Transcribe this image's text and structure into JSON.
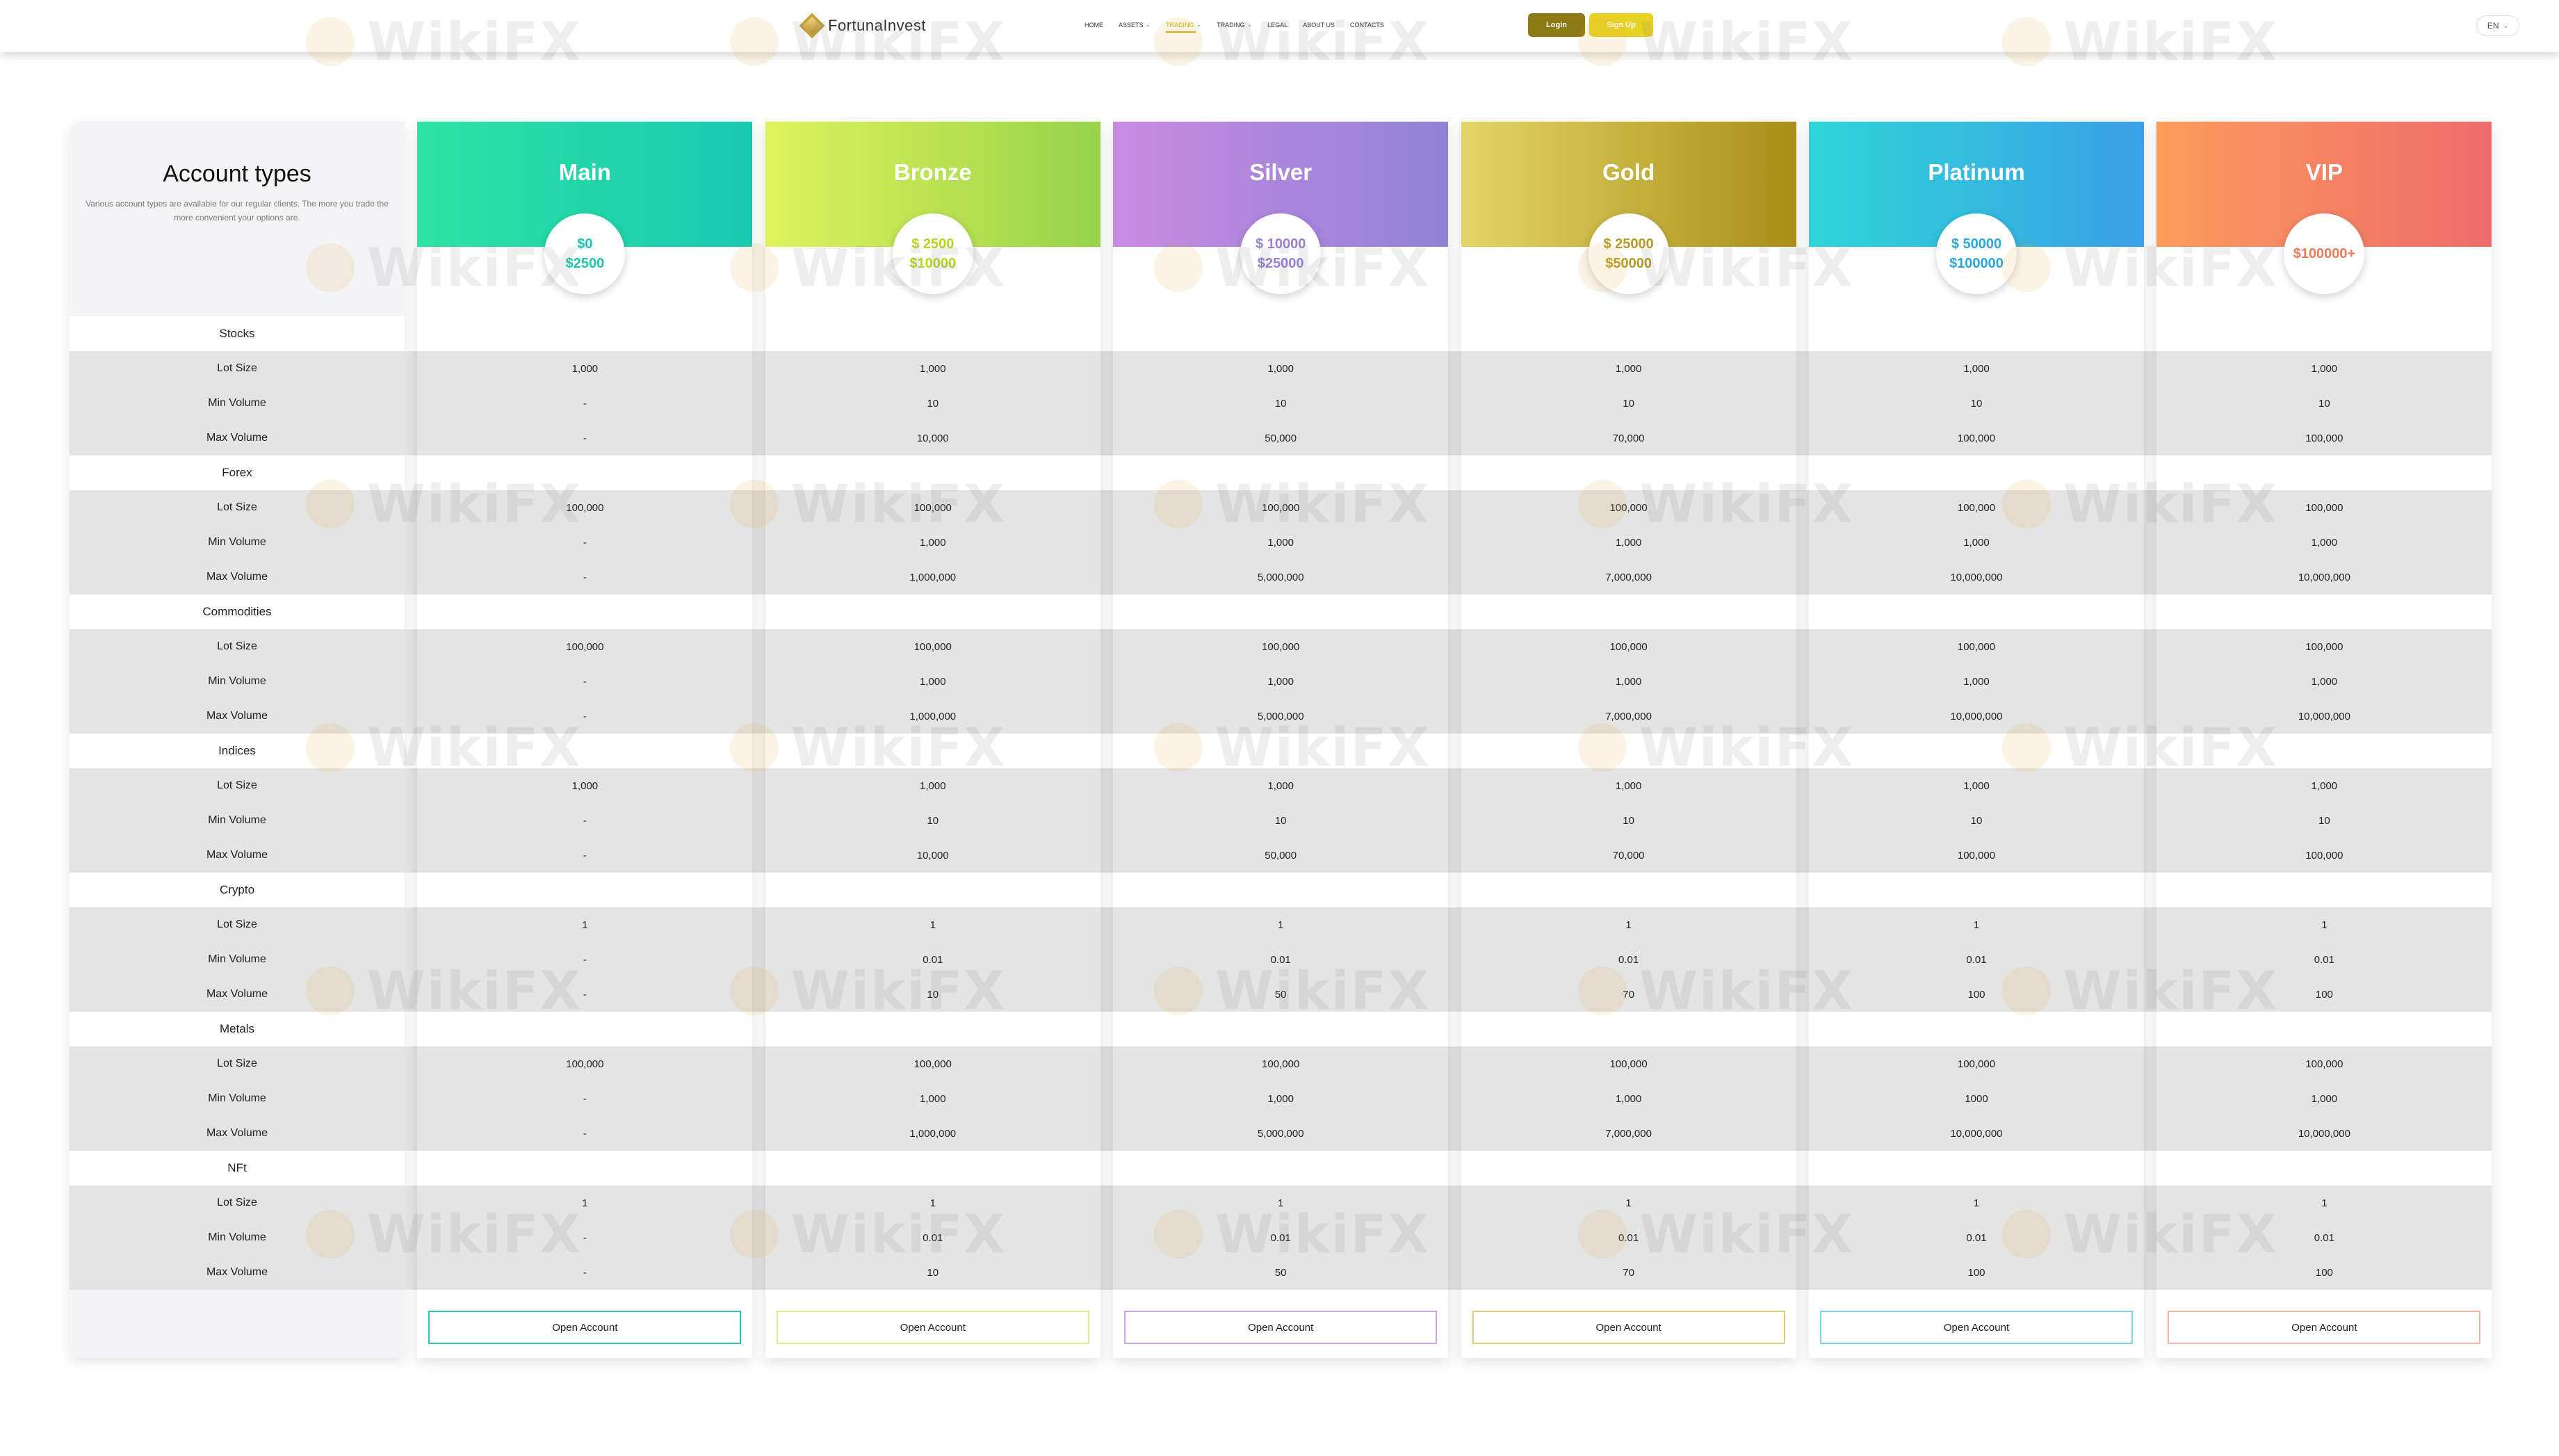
{
  "header": {
    "brand": "FortunaInvest",
    "nav": [
      {
        "label": "HOME",
        "dropdown": false,
        "active": false
      },
      {
        "label": "ASSETS",
        "dropdown": true,
        "active": false
      },
      {
        "label": "TRADING",
        "dropdown": true,
        "active": true
      },
      {
        "label": "TRADING",
        "dropdown": true,
        "active": false
      },
      {
        "label": "LEGAL",
        "dropdown": false,
        "active": false
      },
      {
        "label": "ABOUT US",
        "dropdown": false,
        "active": false
      },
      {
        "label": "CONTACTS",
        "dropdown": false,
        "active": false
      }
    ],
    "login_label": "Login",
    "signup_label": "Sign Up",
    "language": "EN"
  },
  "intro": {
    "title": "Account types",
    "description": "Various account types are available for our regular clients. The more you trade the more convenient your options are."
  },
  "accounts": [
    {
      "name": "Main",
      "price_lines": [
        "$0",
        "$2500"
      ],
      "price_color": "#1cc4ac",
      "gradient": [
        "#2be3a3",
        "#18c9b2"
      ],
      "button_border": "#2ac6b8"
    },
    {
      "name": "Bronze",
      "price_lines": [
        "$ 2500",
        "$10000"
      ],
      "price_color": "#b6d61f",
      "gradient": [
        "#def35a",
        "#96d24a"
      ],
      "button_border": "#d9ef8f"
    },
    {
      "name": "Silver",
      "price_lines": [
        "$ 10000",
        "$25000"
      ],
      "price_color": "#9b7fd8",
      "gradient": [
        "#c98ae0",
        "#8f82d8"
      ],
      "button_border": "#c9a5ea"
    },
    {
      "name": "Gold",
      "price_lines": [
        "$ 25000",
        "$50000"
      ],
      "price_color": "#b39a26",
      "gradient": [
        "#e3d565",
        "#a88d18"
      ],
      "button_border": "#dccf7a"
    },
    {
      "name": "Platinum",
      "price_lines": [
        "$ 50000",
        "$100000"
      ],
      "price_color": "#2aa6dd",
      "gradient": [
        "#2ed5d8",
        "#3aa0e6"
      ],
      "button_border": "#7fd3e3"
    },
    {
      "name": "VIP",
      "price_lines": [
        "$100000+"
      ],
      "price_color": "#ee7a5a",
      "gradient": [
        "#ff9a5c",
        "#ec6c6a"
      ],
      "button_border": "#f6b5a0"
    }
  ],
  "sections": [
    {
      "name": "Stocks",
      "rows": [
        {
          "label": "Lot Size",
          "values": [
            "1,000",
            "1,000",
            "1,000",
            "1,000",
            "1,000",
            "1,000"
          ]
        },
        {
          "label": "Min Volume",
          "values": [
            "-",
            "10",
            "10",
            "10",
            "10",
            "10"
          ]
        },
        {
          "label": "Max Volume",
          "values": [
            "-",
            "10,000",
            "50,000",
            "70,000",
            "100,000",
            "100,000"
          ]
        }
      ]
    },
    {
      "name": "Forex",
      "rows": [
        {
          "label": "Lot Size",
          "values": [
            "100,000",
            "100,000",
            "100,000",
            "100,000",
            "100,000",
            "100,000"
          ]
        },
        {
          "label": "Min Volume",
          "values": [
            "-",
            "1,000",
            "1,000",
            "1,000",
            "1,000",
            "1,000"
          ]
        },
        {
          "label": "Max Volume",
          "values": [
            "-",
            "1,000,000",
            "5,000,000",
            "7,000,000",
            "10,000,000",
            "10,000,000"
          ]
        }
      ]
    },
    {
      "name": "Commodities",
      "rows": [
        {
          "label": "Lot Size",
          "values": [
            "100,000",
            "100,000",
            "100,000",
            "100,000",
            "100,000",
            "100,000"
          ]
        },
        {
          "label": "Min Volume",
          "values": [
            "-",
            "1,000",
            "1,000",
            "1,000",
            "1,000",
            "1,000"
          ]
        },
        {
          "label": "Max Volume",
          "values": [
            "-",
            "1,000,000",
            "5,000,000",
            "7,000,000",
            "10,000,000",
            "10,000,000"
          ]
        }
      ]
    },
    {
      "name": "Indices",
      "rows": [
        {
          "label": "Lot Size",
          "values": [
            "1,000",
            "1,000",
            "1,000",
            "1,000",
            "1,000",
            "1,000"
          ]
        },
        {
          "label": "Min Volume",
          "values": [
            "-",
            "10",
            "10",
            "10",
            "10",
            "10"
          ]
        },
        {
          "label": "Max Volume",
          "values": [
            "-",
            "10,000",
            "50,000",
            "70,000",
            "100,000",
            "100,000"
          ]
        }
      ]
    },
    {
      "name": "Crypto",
      "rows": [
        {
          "label": "Lot Size",
          "values": [
            "1",
            "1",
            "1",
            "1",
            "1",
            "1"
          ]
        },
        {
          "label": "Min Volume",
          "values": [
            "-",
            "0.01",
            "0.01",
            "0.01",
            "0.01",
            "0.01"
          ]
        },
        {
          "label": "Max Volume",
          "values": [
            "-",
            "10",
            "50",
            "70",
            "100",
            "100"
          ]
        }
      ]
    },
    {
      "name": "Metals",
      "rows": [
        {
          "label": "Lot Size",
          "values": [
            "100,000",
            "100,000",
            "100,000",
            "100,000",
            "100,000",
            "100,000"
          ]
        },
        {
          "label": "Min Volume",
          "values": [
            "-",
            "1,000",
            "1,000",
            "1,000",
            "1000",
            "1,000"
          ]
        },
        {
          "label": "Max Volume",
          "values": [
            "-",
            "1,000,000",
            "5,000,000",
            "7,000,000",
            "10,000,000",
            "10,000,000"
          ]
        }
      ]
    },
    {
      "name": "NFt",
      "rows": [
        {
          "label": "Lot Size",
          "values": [
            "1",
            "1",
            "1",
            "1",
            "1",
            "1"
          ]
        },
        {
          "label": "Min Volume",
          "values": [
            "-",
            "0.01",
            "0.01",
            "0.01",
            "0.01",
            "0.01"
          ]
        },
        {
          "label": "Max Volume",
          "values": [
            "-",
            "10",
            "50",
            "70",
            "100",
            "100"
          ]
        }
      ]
    }
  ],
  "open_account_label": "Open Account",
  "watermark_text": "WikiFX"
}
